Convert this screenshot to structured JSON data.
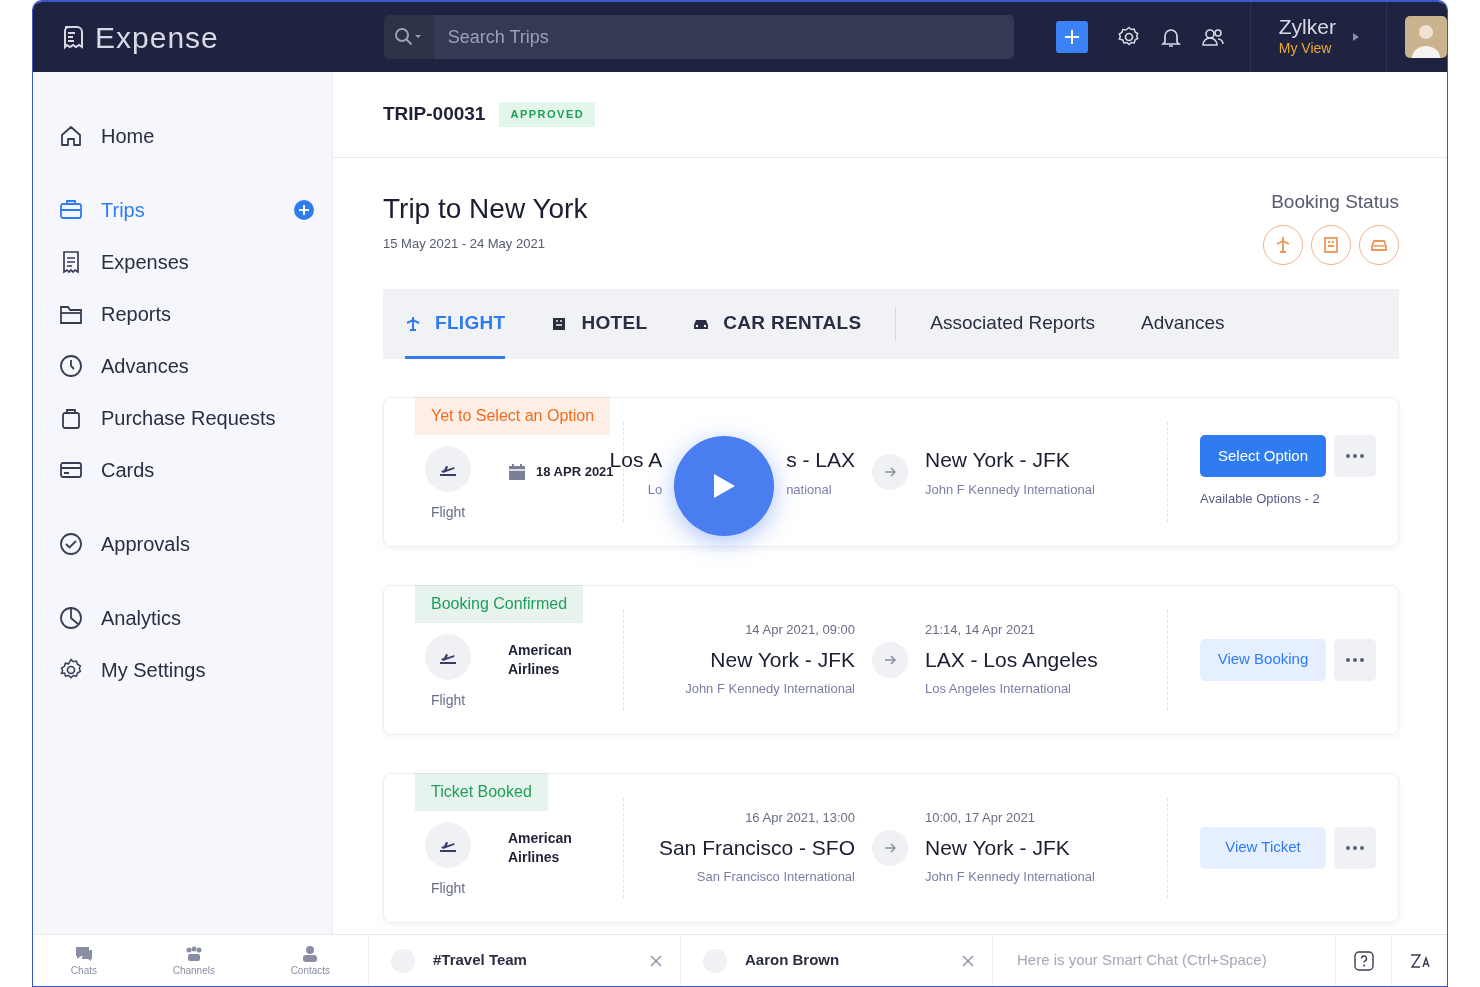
{
  "header": {
    "app_name": "Expense",
    "search": {
      "placeholder": "Search Trips"
    },
    "org": {
      "name": "Zylker",
      "view": "My View"
    }
  },
  "sidebar": {
    "sections": [
      [
        {
          "label": "Home",
          "selected": false
        }
      ],
      [
        {
          "label": "Trips",
          "selected": true,
          "add": true
        },
        {
          "label": "Expenses",
          "selected": false
        },
        {
          "label": "Reports",
          "selected": false
        },
        {
          "label": "Advances",
          "selected": false
        },
        {
          "label": "Purchase Requests",
          "selected": false
        },
        {
          "label": "Cards",
          "selected": false
        }
      ],
      [
        {
          "label": "Approvals",
          "selected": false
        }
      ],
      [
        {
          "label": "Analytics",
          "selected": false
        },
        {
          "label": "My Settings",
          "selected": false
        }
      ]
    ]
  },
  "trip": {
    "id": "TRIP-00031",
    "status": "APPROVED",
    "title": "Trip to New York",
    "dates": "15 May 2021 - 24 May 2021",
    "booking_status_label": "Booking Status"
  },
  "tabs": [
    {
      "label": "FLIGHT",
      "kind": "booking",
      "selected": true
    },
    {
      "label": "HOTEL",
      "kind": "booking",
      "selected": false
    },
    {
      "label": "CAR RENTALS",
      "kind": "booking",
      "selected": false
    },
    {
      "label": "Associated Reports",
      "kind": "section",
      "selected": false
    },
    {
      "label": "Advances",
      "kind": "section",
      "selected": false
    }
  ],
  "bookings": [
    {
      "status": "Yet to Select an Option",
      "color": "#f26b1d",
      "type": "Flight",
      "date": "18 APR 2021",
      "from": {
        "city": [
          "Los A",
          "s - LAX"
        ],
        "airport": [
          "Lo",
          "national"
        ]
      },
      "to": {
        "city": "New York - JFK",
        "airport": "John F Kennedy International"
      },
      "action": {
        "label": "Select Option",
        "kind": "primary"
      },
      "note": "Available Options - 2",
      "video_overlay": true
    },
    {
      "status": "Booking Confirmed",
      "color": "#1e9e5a",
      "type": "Flight",
      "airline": "American Airlines",
      "from": {
        "time": "14 Apr 2021, 09:00",
        "city": [
          "New York - JFK"
        ],
        "airport": [
          "John F Kennedy International"
        ]
      },
      "to": {
        "time": "21:14, 14 Apr 2021",
        "city": "LAX - Los Angeles",
        "airport": "Los Angeles International"
      },
      "action": {
        "label": "View Booking",
        "kind": "light"
      }
    },
    {
      "status": "Ticket Booked",
      "color": "#1e9e5a",
      "type": "Flight",
      "airline": "American Airlines",
      "from": {
        "time": "16 Apr 2021, 13:00",
        "city": [
          "San Francisco - SFO"
        ],
        "airport": [
          "San Francisco International"
        ]
      },
      "to": {
        "time": "10:00, 17 Apr 2021",
        "city": "New York - JFK",
        "airport": "John F Kennedy International"
      },
      "action": {
        "label": "View Ticket",
        "kind": "light"
      }
    }
  ],
  "chat_bar": {
    "nav": [
      "Chats",
      "Channels",
      "Contacts"
    ],
    "chats": [
      "#Travel Team",
      "Aaron Brown"
    ],
    "smart_chat": {
      "placeholder": "Here is your Smart Chat (Ctrl+Space)"
    }
  }
}
